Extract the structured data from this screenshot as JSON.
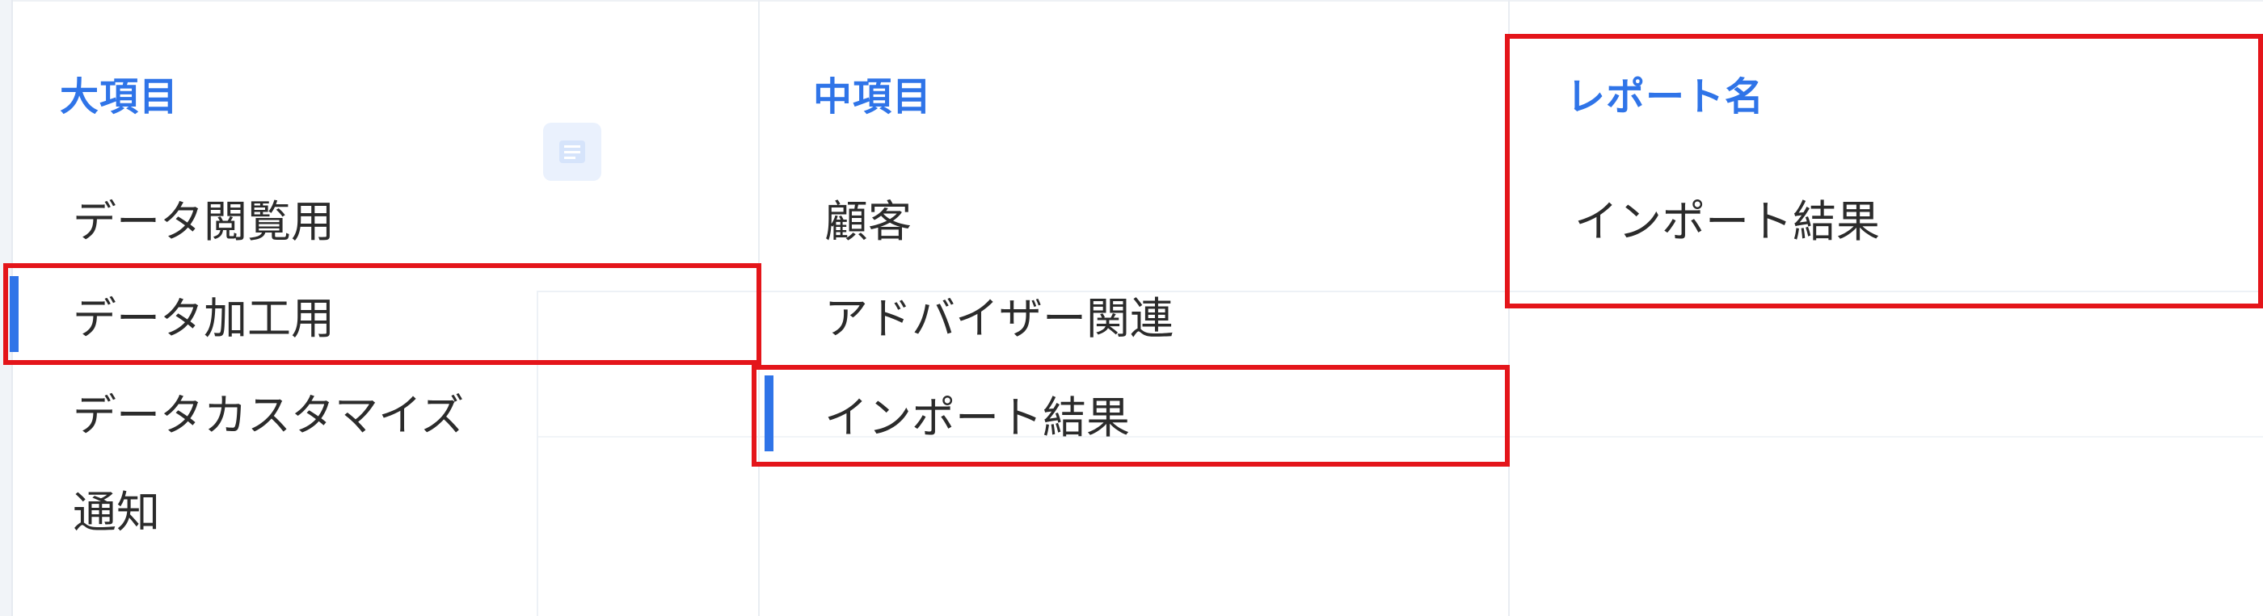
{
  "columns": {
    "major": {
      "header": "大項目",
      "items": [
        {
          "label": "データ閲覧用"
        },
        {
          "label": "データ加工用"
        },
        {
          "label": "データカスタマイズ"
        },
        {
          "label": "通知"
        }
      ],
      "selected_index": 1
    },
    "middle": {
      "header": "中項目",
      "items": [
        {
          "label": "顧客"
        },
        {
          "label": "アドバイザー関連"
        },
        {
          "label": "インポート結果"
        }
      ],
      "selected_index": 2
    },
    "report": {
      "header": "レポート名",
      "items": [
        {
          "label": "インポート結果"
        }
      ]
    }
  },
  "colors": {
    "accent": "#2f74e8",
    "highlight_box": "#e4151a",
    "text": "#2b2b2b"
  },
  "icons": {
    "ghost_icon": "list-icon"
  }
}
